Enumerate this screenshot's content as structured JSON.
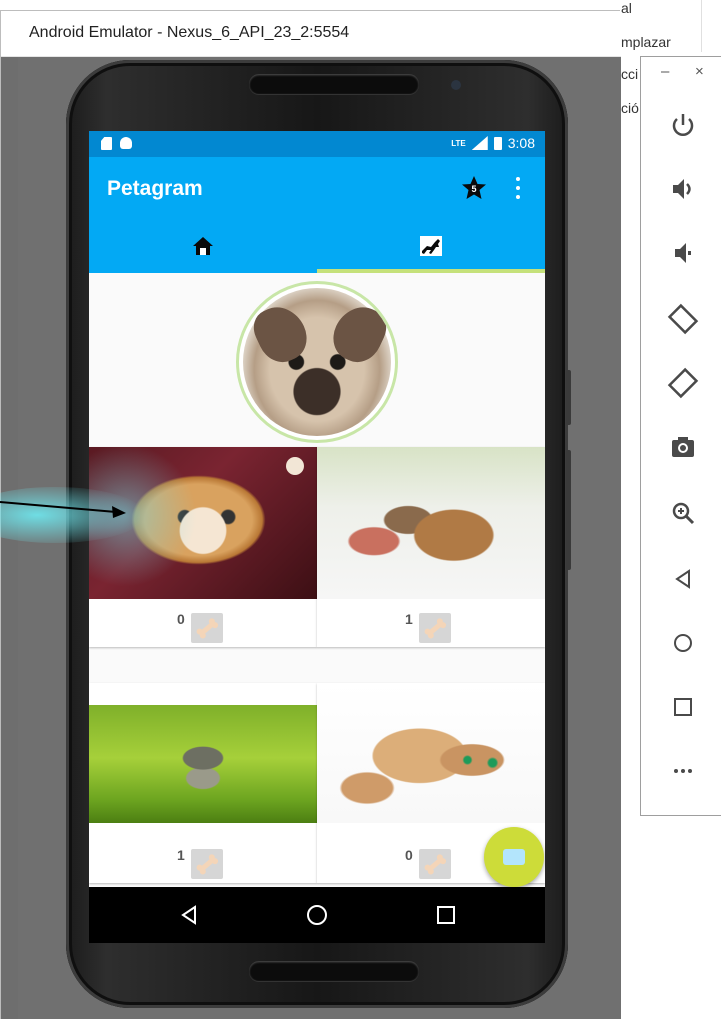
{
  "background_doc": {
    "lines": [
      "al",
      "mplazar",
      "cci",
      "ció"
    ]
  },
  "emulator": {
    "window_title": "Android Emulator - Nexus_6_API_23_2:5554",
    "side_panel": {
      "minimize_label": "–",
      "close_label": "×",
      "buttons": [
        "power-icon",
        "volume-up-icon",
        "volume-down-icon",
        "rotate-left-icon",
        "rotate-right-icon",
        "screenshot-icon",
        "zoom-icon",
        "back-icon",
        "home-icon",
        "overview-icon",
        "more-icon"
      ]
    }
  },
  "phone": {
    "status_bar": {
      "time": "3:08",
      "network": "LTE"
    },
    "app_bar": {
      "title": "Petagram",
      "actions": [
        "favorites-star-icon",
        "overflow-menu-icon"
      ],
      "star_badge": "5"
    },
    "tabs": [
      {
        "icon": "home-icon",
        "selected": false
      },
      {
        "icon": "dog-profile-icon",
        "selected": true
      }
    ],
    "accent_color": "#c5e17a",
    "primary_color": "#03a9f4",
    "primary_dark_color": "#0288d1",
    "fab_color": "#cddc39",
    "pets": [
      {
        "image": "cat-in-bread",
        "likes": "0"
      },
      {
        "image": "sleeping-kitten",
        "likes": "1"
      },
      {
        "image": "jumping-kitten-grass",
        "likes": "1"
      },
      {
        "image": "playful-kitten",
        "likes": "0"
      }
    ],
    "fab": {
      "icon": "camera-icon"
    },
    "nav_bar": [
      "back-icon",
      "home-icon",
      "overview-icon"
    ]
  }
}
